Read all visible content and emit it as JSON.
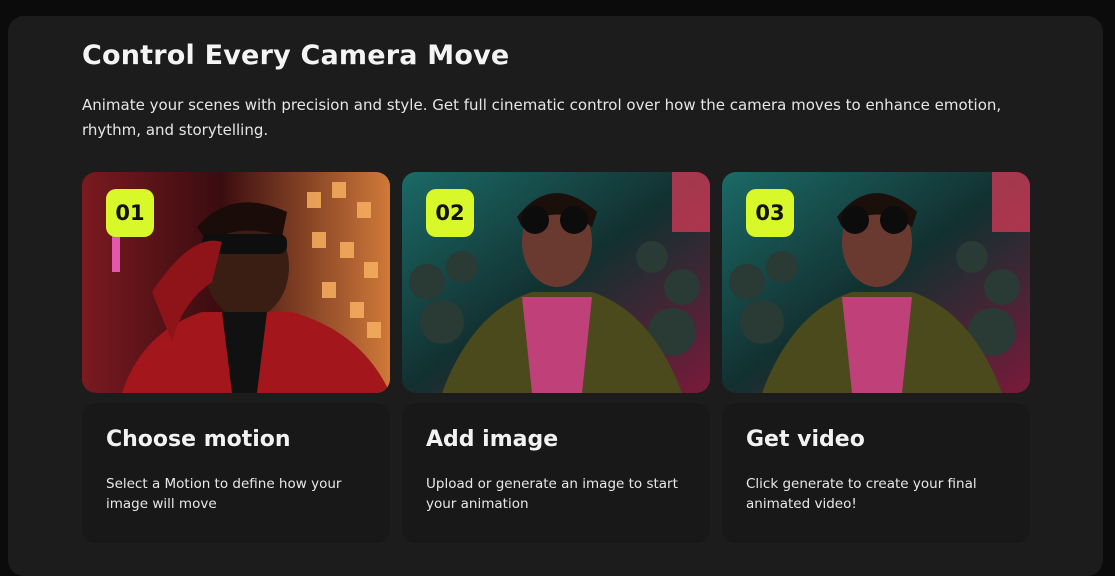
{
  "section": {
    "title": "Control Every Camera Move",
    "subtitle": "Animate your scenes with precision and style. Get full cinematic control over how the camera moves to enhance emotion, rhythm, and storytelling."
  },
  "steps": [
    {
      "number": "01",
      "title": "Choose motion",
      "description": "Select a Motion to define how your image will move",
      "image": "man-red-suit-sunglasses-neon-street"
    },
    {
      "number": "02",
      "title": "Add image",
      "description": "Upload or generate an image to start your animation",
      "image": "man-sunglasses-crowd-club"
    },
    {
      "number": "03",
      "title": "Get video",
      "description": "Click generate to create your final animated video!",
      "image": "man-sunglasses-crowd-club"
    }
  ],
  "colors": {
    "accent": "#d8f82a",
    "panel": "#1c1c1c",
    "card": "#181818"
  }
}
